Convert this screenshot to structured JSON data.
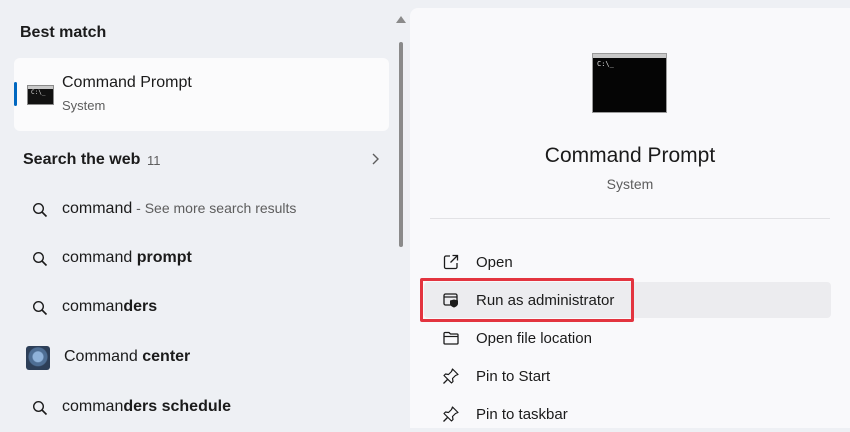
{
  "left": {
    "best_match_title": "Best match",
    "best_match": {
      "title": "Command Prompt",
      "subtitle": "System"
    },
    "web": {
      "title": "Search the web",
      "count": "11"
    },
    "results": [
      {
        "plain": "command",
        "bold": "",
        "hint": " - See more search results"
      },
      {
        "plain": "command ",
        "bold": "prompt",
        "hint": ""
      },
      {
        "plain": "comman",
        "bold": "ders",
        "hint": ""
      },
      {
        "plain": "Command ",
        "bold": "center",
        "hint": ""
      },
      {
        "plain": "comman",
        "bold": "ders schedule",
        "hint": ""
      }
    ]
  },
  "right": {
    "app_title": "Command Prompt",
    "app_subtitle": "System",
    "actions": [
      {
        "label": "Open",
        "icon": "open-external-icon"
      },
      {
        "label": "Run as administrator",
        "icon": "admin-shield-icon"
      },
      {
        "label": "Open file location",
        "icon": "folder-icon"
      },
      {
        "label": "Pin to Start",
        "icon": "pin-icon"
      },
      {
        "label": "Pin to taskbar",
        "icon": "pin-icon"
      }
    ]
  },
  "icon_text": "C:\\_",
  "colors": {
    "accent": "#0067c0",
    "highlight": "#e3343f"
  }
}
